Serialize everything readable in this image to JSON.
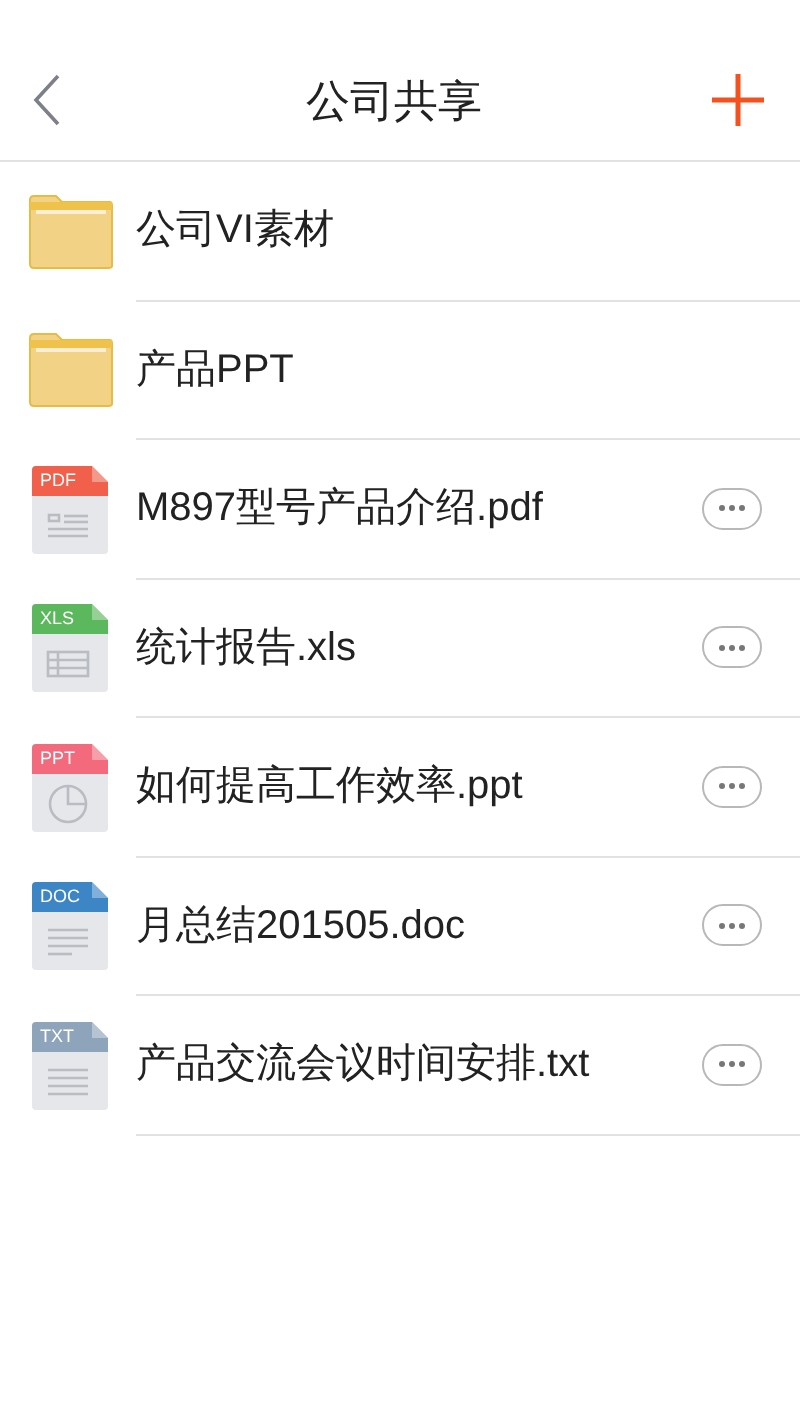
{
  "header": {
    "title": "公司共享"
  },
  "items": [
    {
      "kind": "folder",
      "name": "公司VI素材"
    },
    {
      "kind": "folder",
      "name": "产品PPT"
    },
    {
      "kind": "pdf",
      "name": "M897型号产品介绍.pdf",
      "badge": "PDF",
      "color": "#f0604a"
    },
    {
      "kind": "xls",
      "name": "统计报告.xls",
      "badge": "XLS",
      "color": "#5cb85c"
    },
    {
      "kind": "ppt",
      "name": "如何提高工作效率.ppt",
      "badge": "PPT",
      "color": "#f36a7c"
    },
    {
      "kind": "doc",
      "name": "月总结201505.doc",
      "badge": "DOC",
      "color": "#3d86c6"
    },
    {
      "kind": "txt",
      "name": "产品交流会议时间安排.txt",
      "badge": "TXT",
      "color": "#8ea4ba"
    }
  ]
}
